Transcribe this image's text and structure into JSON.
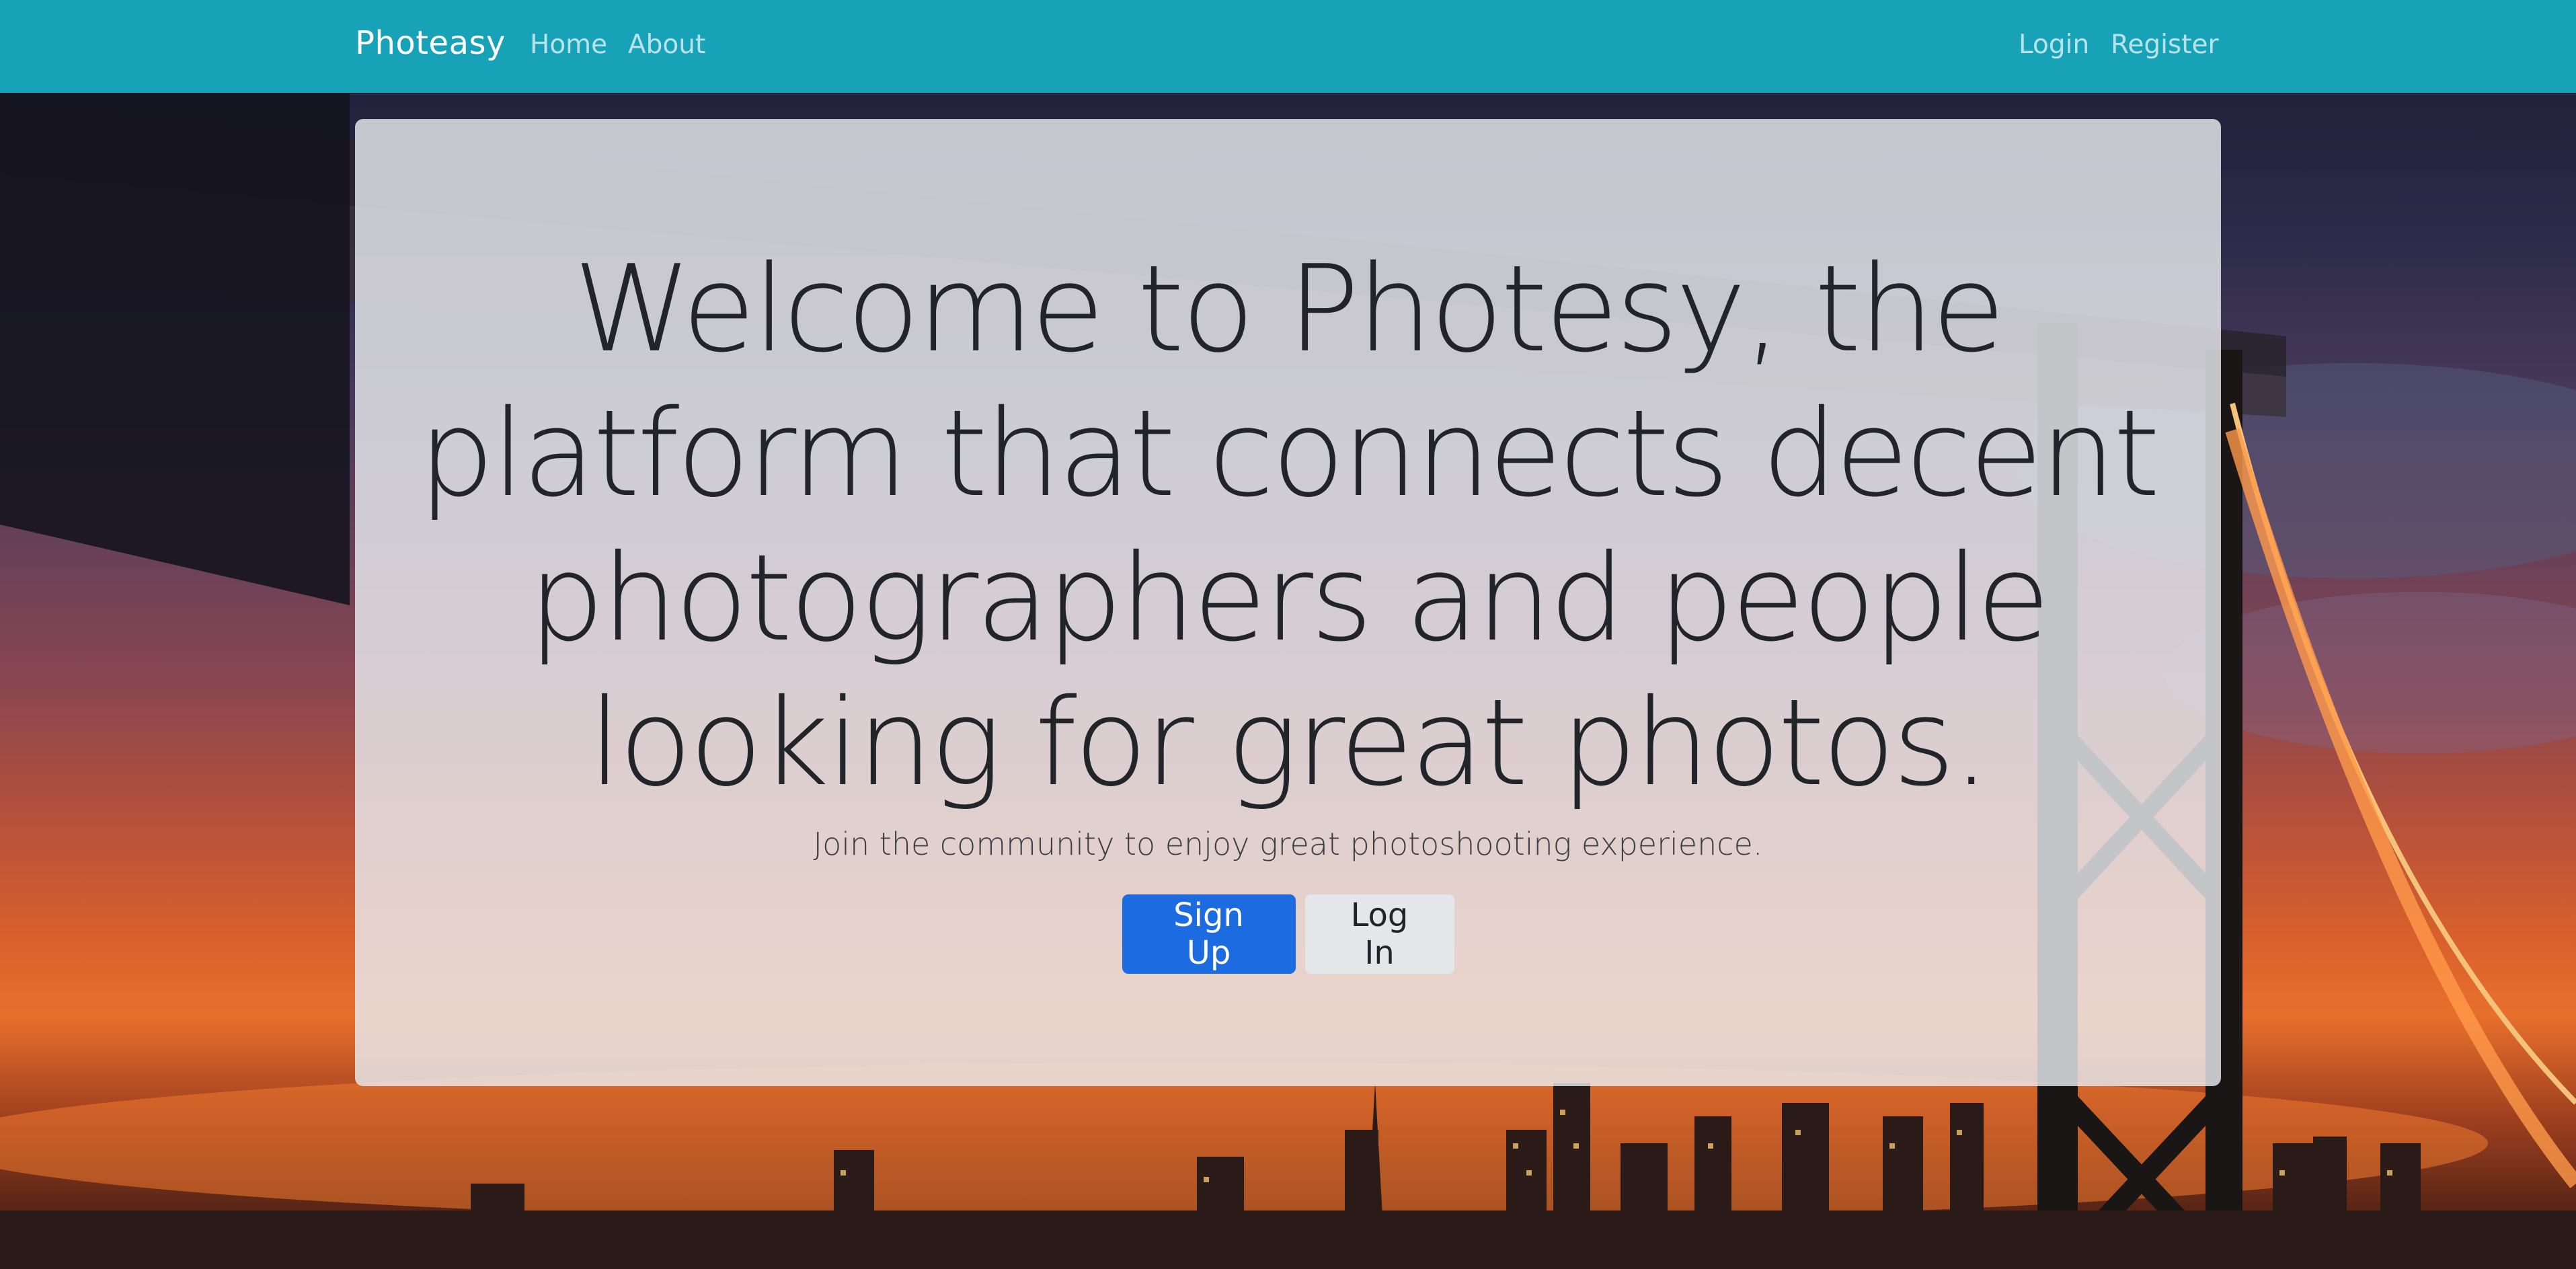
{
  "navbar": {
    "brand": "Photeasy",
    "links_left": [
      "Home",
      "About"
    ],
    "links_right": [
      "Login",
      "Register"
    ],
    "color": "#17a2b8"
  },
  "hero": {
    "headline": "Welcome to Photesy, the platform that connects decent photographers and people looking for great photos.",
    "lead": "Join the community to enjoy great photoshooting experience.",
    "signup_label": "Sign Up",
    "login_label": "Log In",
    "primary_color": "#1d6be0"
  },
  "background": {
    "description_icon": "bridge-city-sunset-photo"
  }
}
